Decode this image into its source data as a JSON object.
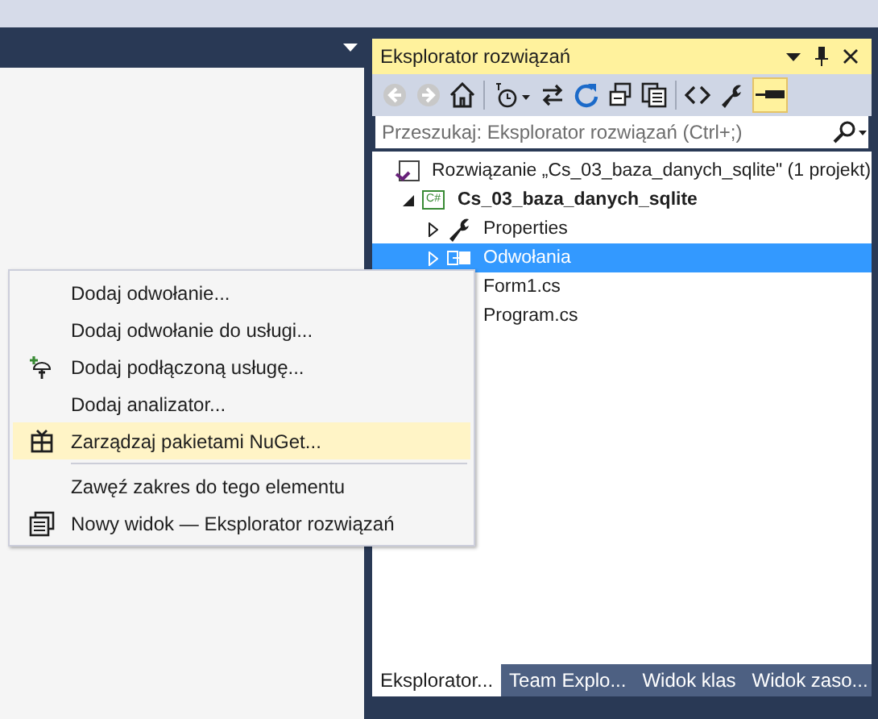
{
  "solution_explorer": {
    "title": "Eksplorator rozwiązań",
    "toolbar": {
      "back_disabled": true,
      "forward_disabled": true,
      "preview_selected": true
    },
    "search": {
      "placeholder": "Przeszukaj: Eksplorator rozwiązań (Ctrl+;)"
    },
    "tree": [
      {
        "kind": "solution",
        "label": "Rozwiązanie „Cs_03_baza_danych_sqlite\" (1 projekt)",
        "selected": false,
        "children": [
          {
            "kind": "project",
            "icon_text": "C#",
            "label": "Cs_03_baza_danych_sqlite",
            "selected": false,
            "expanded": true,
            "children": [
              {
                "kind": "properties",
                "label": "Properties",
                "selected": false,
                "expanded": false
              },
              {
                "kind": "references",
                "label": "Odwołania",
                "selected": true,
                "expanded": false
              },
              {
                "kind": "file",
                "label": "Form1.cs",
                "selected": false
              },
              {
                "kind": "file",
                "label": "Program.cs",
                "selected": false
              }
            ]
          }
        ]
      }
    ],
    "tabs": [
      {
        "label": "Eksplorator...",
        "selected": true
      },
      {
        "label": "Team Explo...",
        "selected": false
      },
      {
        "label": "Widok klas",
        "selected": false
      },
      {
        "label": "Widok zaso...",
        "selected": false
      }
    ]
  },
  "context_menu": [
    {
      "kind": "item",
      "label": "Dodaj odwołanie...",
      "hovered": false
    },
    {
      "kind": "item",
      "label": "Dodaj odwołanie do usługi...",
      "hovered": false
    },
    {
      "kind": "service",
      "label": "Dodaj podłączoną usługę...",
      "hovered": false
    },
    {
      "kind": "item",
      "label": "Dodaj analizator...",
      "hovered": false
    },
    {
      "kind": "package",
      "label": "Zarządzaj pakietami NuGet...",
      "hovered": true
    },
    {
      "kind": "separator"
    },
    {
      "kind": "item",
      "label": "Zawęź zakres do tego elementu",
      "hovered": false
    },
    {
      "kind": "view",
      "label": "Nowy widok — Eksplorator rozwiązań",
      "hovered": false
    }
  ]
}
